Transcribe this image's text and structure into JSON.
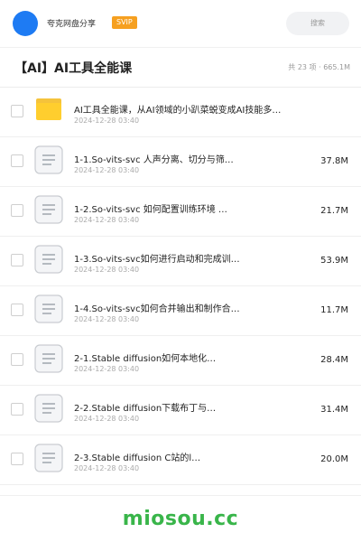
{
  "header": {
    "site_name": "夸克网盘分享",
    "badge": "SVIP",
    "search_placeholder": "搜索"
  },
  "folder": {
    "title": "【AI】AI工具全能课",
    "summary": "共 23 项 · 665.1M"
  },
  "items": [
    {
      "type": "folder",
      "name": "AI工具全能课，从AI领域的小趴菜蜕变成AI技能多…",
      "date": "2024-12-28 03:40",
      "size": ""
    },
    {
      "type": "file",
      "name": "1-1.So-vits-svc 人声分离、切分与筛…",
      "date": "2024-12-28 03:40",
      "size": "37.8M"
    },
    {
      "type": "file",
      "name": "1-2.So-vits-svc 如何配置训练环境 …",
      "date": "2024-12-28 03:40",
      "size": "21.7M"
    },
    {
      "type": "file",
      "name": "1-3.So-vits-svc如何进行启动和完成训…",
      "date": "2024-12-28 03:40",
      "size": "53.9M"
    },
    {
      "type": "file",
      "name": "1-4.So-vits-svc如何合并输出和制作合…",
      "date": "2024-12-28 03:40",
      "size": "11.7M"
    },
    {
      "type": "file",
      "name": "2-1.Stable diffusion如何本地化…",
      "date": "2024-12-28 03:40",
      "size": "28.4M"
    },
    {
      "type": "file",
      "name": "2-2.Stable diffusion下载布丁与…",
      "date": "2024-12-28 03:40",
      "size": "31.4M"
    },
    {
      "type": "file",
      "name": "2-3.Stable diffusion C站的l…",
      "date": "2024-12-28 03:40",
      "size": "20.0M"
    }
  ],
  "watermark": "miosou.cc",
  "colors": {
    "avatar": "#1e7bf3",
    "badge": "#f6a020",
    "folder": "#ffce2e",
    "watermark": "#39b54a"
  }
}
